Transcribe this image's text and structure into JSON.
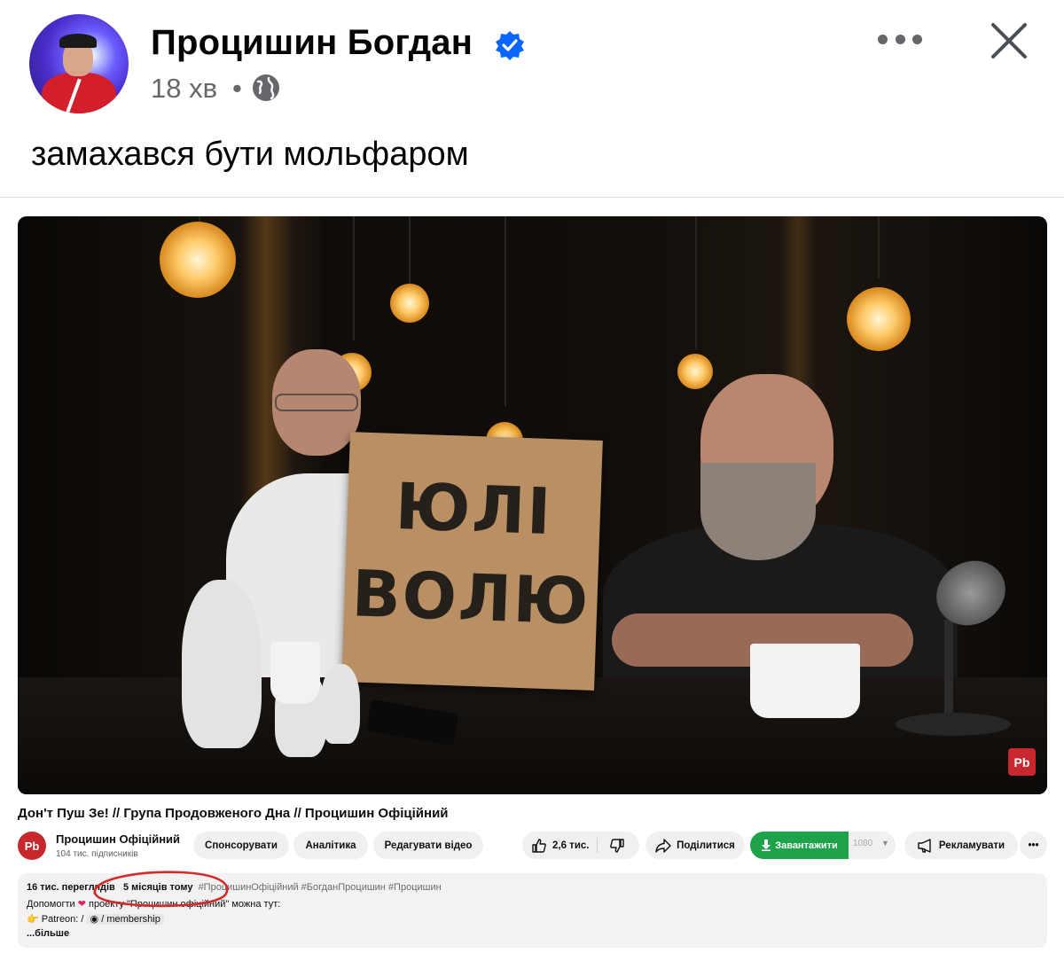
{
  "post": {
    "author_name": "Процишин Богдан",
    "time": "18 хв",
    "dot": "•",
    "text": "замахався бути мольфаром"
  },
  "video_frame": {
    "sign_line1": "ЮЛІ",
    "sign_line2": "ВОЛЮ",
    "watermark": "Pb"
  },
  "youtube": {
    "title": "Дон'т Пуш Зе! // Група Продовженого Дна // Процишин Офіційний",
    "channel_logo": "Pb",
    "channel_name": "Процишин Офіційний",
    "subscribers": "104 тис. підписників",
    "buttons": {
      "sponsor": "Спонсорувати",
      "analytics": "Аналітика",
      "edit_video": "Редагувати відео",
      "likes": "2,6 тис.",
      "share": "Поділитися",
      "download": "Завантажити",
      "quality": "1080",
      "promote": "Рекламувати",
      "more": "•••"
    },
    "description": {
      "views": "16 тис. переглядів",
      "age": "5 місяців тому",
      "tags": "#ПроцишинОфіційний #БогданПроцишин #Процишин",
      "support_prefix": "Допомогти",
      "support_suffix": "проекту \"Процишин офіційний\" можна тут:",
      "patreon": "Patreon: /",
      "membership": "/ membership",
      "more": "...більше"
    }
  },
  "colors": {
    "verified_blue": "#0866ff",
    "download_green": "#1fa34a",
    "annotation_red": "#d42a2a",
    "brand_red": "#c6282e"
  }
}
